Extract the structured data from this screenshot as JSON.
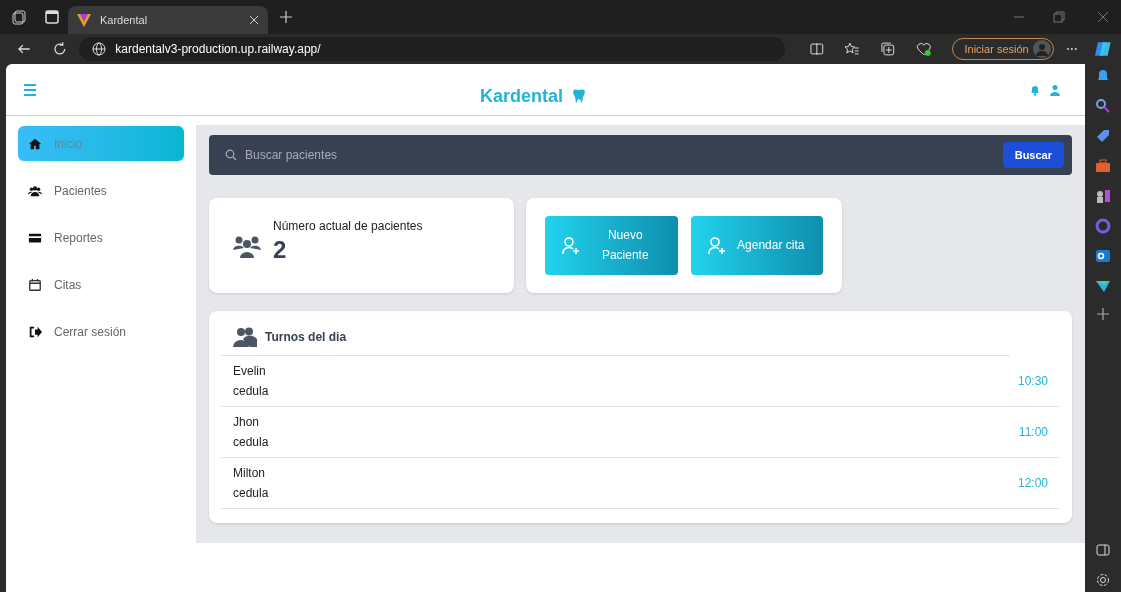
{
  "browser": {
    "tabs": [
      {
        "title": "Kardental",
        "selected": true
      }
    ],
    "url": "kardentalv3-production.up.railway.app/",
    "sign_in": "Iniciar sesión"
  },
  "header": {
    "title": "Kardental"
  },
  "sidebar": {
    "items": [
      {
        "label": "Inicio",
        "selected": true
      },
      {
        "label": "Pacientes",
        "selected": false
      },
      {
        "label": "Reportes",
        "selected": false
      },
      {
        "label": "Citas",
        "selected": false
      },
      {
        "label": "Cerrar sesión",
        "selected": false
      }
    ]
  },
  "search": {
    "placeholder": "Buscar pacientes",
    "button": "Buscar"
  },
  "stat": {
    "label": "Número actual de pacientes",
    "value": "2"
  },
  "actions": [
    "Nuevo Paciente",
    "Agendar cita"
  ],
  "turnos": {
    "title": "Turnos del dia",
    "rows": [
      {
        "name": "Evelin",
        "id": "cedula",
        "time": "10:30"
      },
      {
        "name": "Jhon",
        "id": "cedula",
        "time": "11:00"
      },
      {
        "name": "Milton",
        "id": "cedula",
        "time": "12:00"
      }
    ]
  }
}
